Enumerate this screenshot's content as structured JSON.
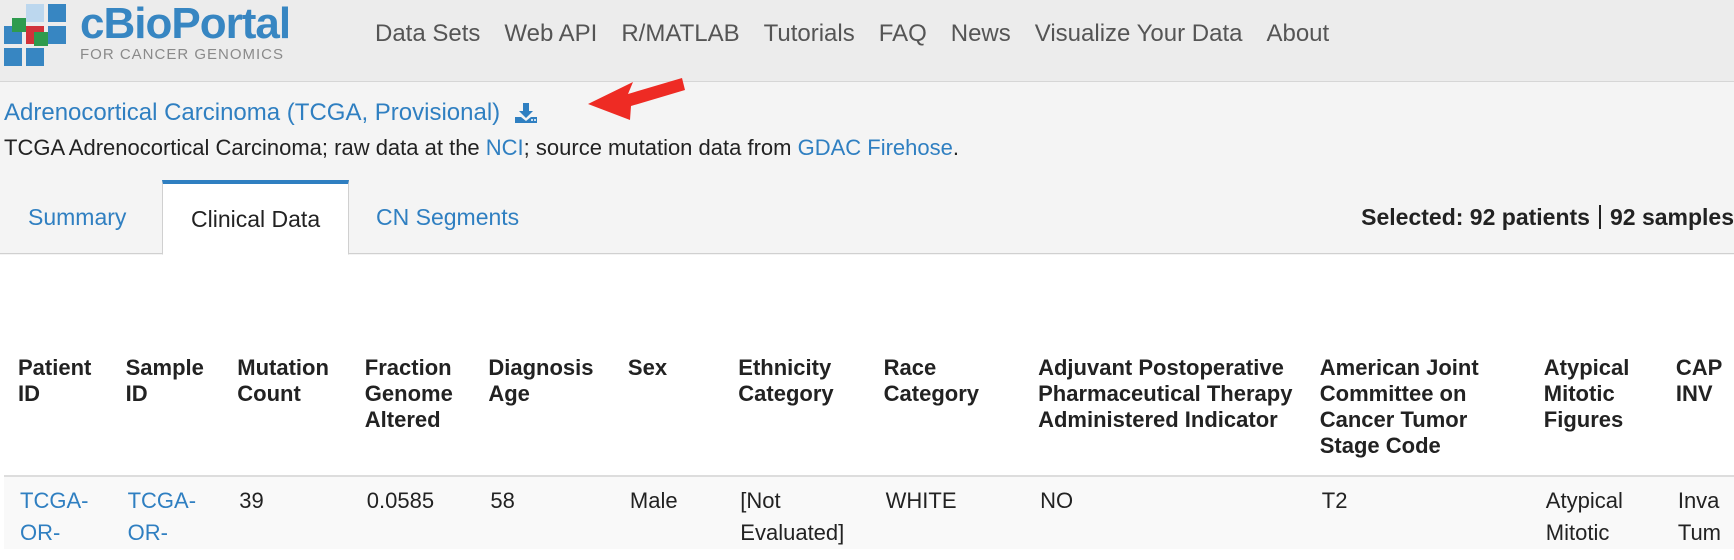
{
  "brand": {
    "name": "cBioPortal",
    "tagline": "FOR CANCER GENOMICS",
    "colors": {
      "primary": "#3786c2",
      "accent_red": "#d1323a",
      "accent_green": "#2e9b4e"
    }
  },
  "nav": {
    "items": [
      "Data Sets",
      "Web API",
      "R/MATLAB",
      "Tutorials",
      "FAQ",
      "News",
      "Visualize Your Data",
      "About"
    ]
  },
  "study": {
    "title": "Adrenocortical Carcinoma (TCGA, Provisional)",
    "download_icon": "download-icon",
    "desc_prefix": "TCGA Adrenocortical Carcinoma; raw data at the ",
    "desc_link1": "NCI",
    "desc_middle": "; source mutation data from ",
    "desc_link2": "GDAC Firehose",
    "desc_suffix": "."
  },
  "tabs": [
    {
      "label": "Summary",
      "active": false
    },
    {
      "label": "Clinical Data",
      "active": true
    },
    {
      "label": "CN Segments",
      "active": false
    }
  ],
  "selection": {
    "patients": "Selected: 92 patients",
    "samples": "92 samples"
  },
  "table": {
    "headers": [
      "Patient ID",
      "Sample ID",
      "Mutation Count",
      "Fraction Genome Altered",
      "Diagnosis Age",
      "Sex",
      "Ethnicity Category",
      "Race Category",
      "Adjuvant Postoperative Pharmaceutical Therapy Administered Indicator",
      "American Joint Committee on Cancer Tumor Stage Code",
      "Atypical Mitotic Figures",
      "CAP INV"
    ],
    "rows": [
      {
        "patient_id": "TCGA-OR-",
        "sample_id": "TCGA-OR-",
        "mutation_count": "39",
        "fraction_genome_altered": "0.0585",
        "diagnosis_age": "58",
        "sex": "Male",
        "ethnicity": "[Not Evaluated]",
        "race": "WHITE",
        "adjuvant": "NO",
        "ajcc_stage": "T2",
        "atypical_mitotic": "Atypical Mitotic",
        "cap_inv": "Inva Tum"
      }
    ]
  }
}
